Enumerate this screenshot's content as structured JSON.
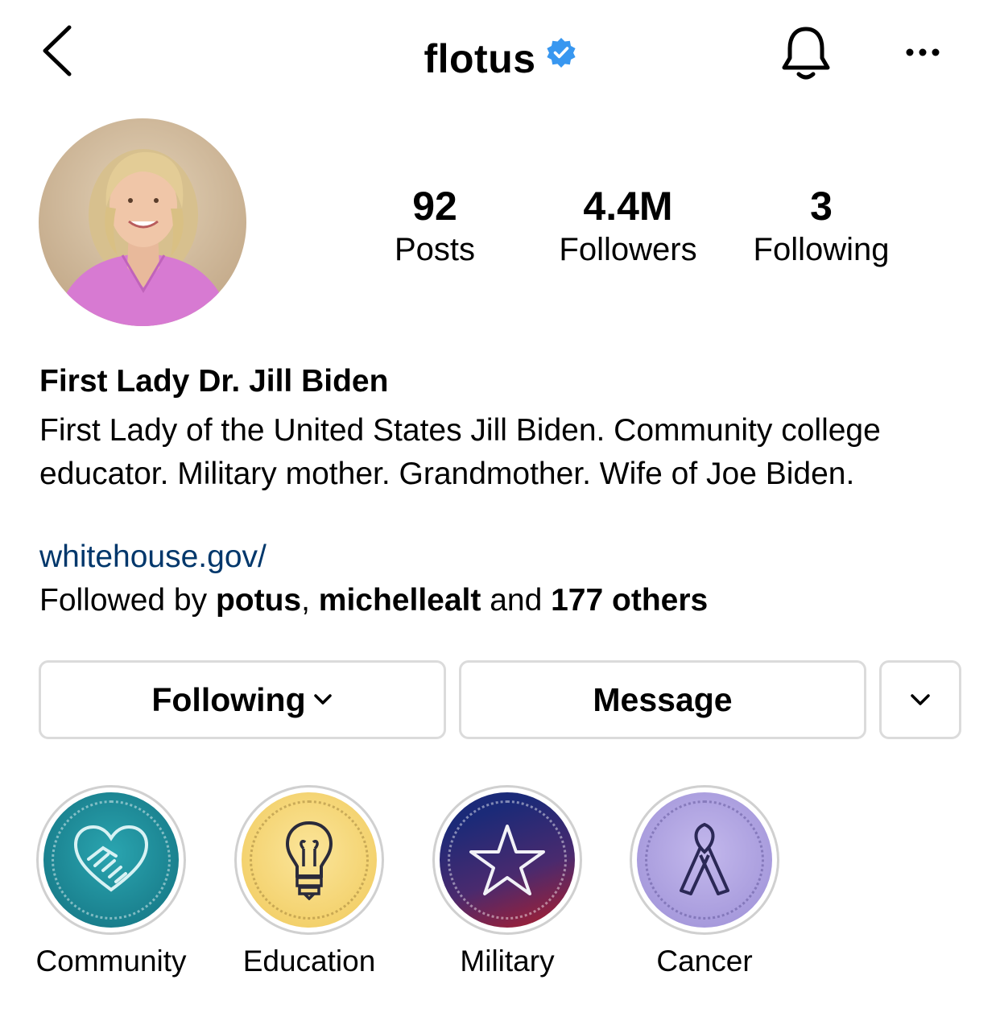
{
  "header": {
    "username": "flotus"
  },
  "stats": [
    {
      "value": "92",
      "label": "Posts"
    },
    {
      "value": "4.4M",
      "label": "Followers"
    },
    {
      "value": "3",
      "label": "Following"
    }
  ],
  "profile": {
    "display_name": "First Lady Dr. Jill Biden",
    "bio": "First Lady of the United States Jill Biden. Community college educator. Military mother. Grandmother. Wife of Joe Biden.",
    "link": "whitehouse.gov/",
    "followed_prefix": "Followed by ",
    "followed_user1": "potus",
    "followed_sep": ", ",
    "followed_user2": "michellealt",
    "followed_and": " and ",
    "followed_others": "177 others"
  },
  "buttons": {
    "following": "Following",
    "message": "Message"
  },
  "highlights": [
    {
      "label": "Community",
      "icon": "handshake-heart-icon",
      "color": "#1a8a99"
    },
    {
      "label": "Education",
      "icon": "lightbulb-icon",
      "color": "#f3d36a"
    },
    {
      "label": "Military",
      "icon": "star-icon",
      "color": "#2a2f7a"
    },
    {
      "label": "Cancer",
      "icon": "ribbon-icon",
      "color": "#a69ad8"
    }
  ],
  "colors": {
    "link": "#00376b",
    "verified": "#3897f0",
    "border": "#dbdbdb"
  }
}
